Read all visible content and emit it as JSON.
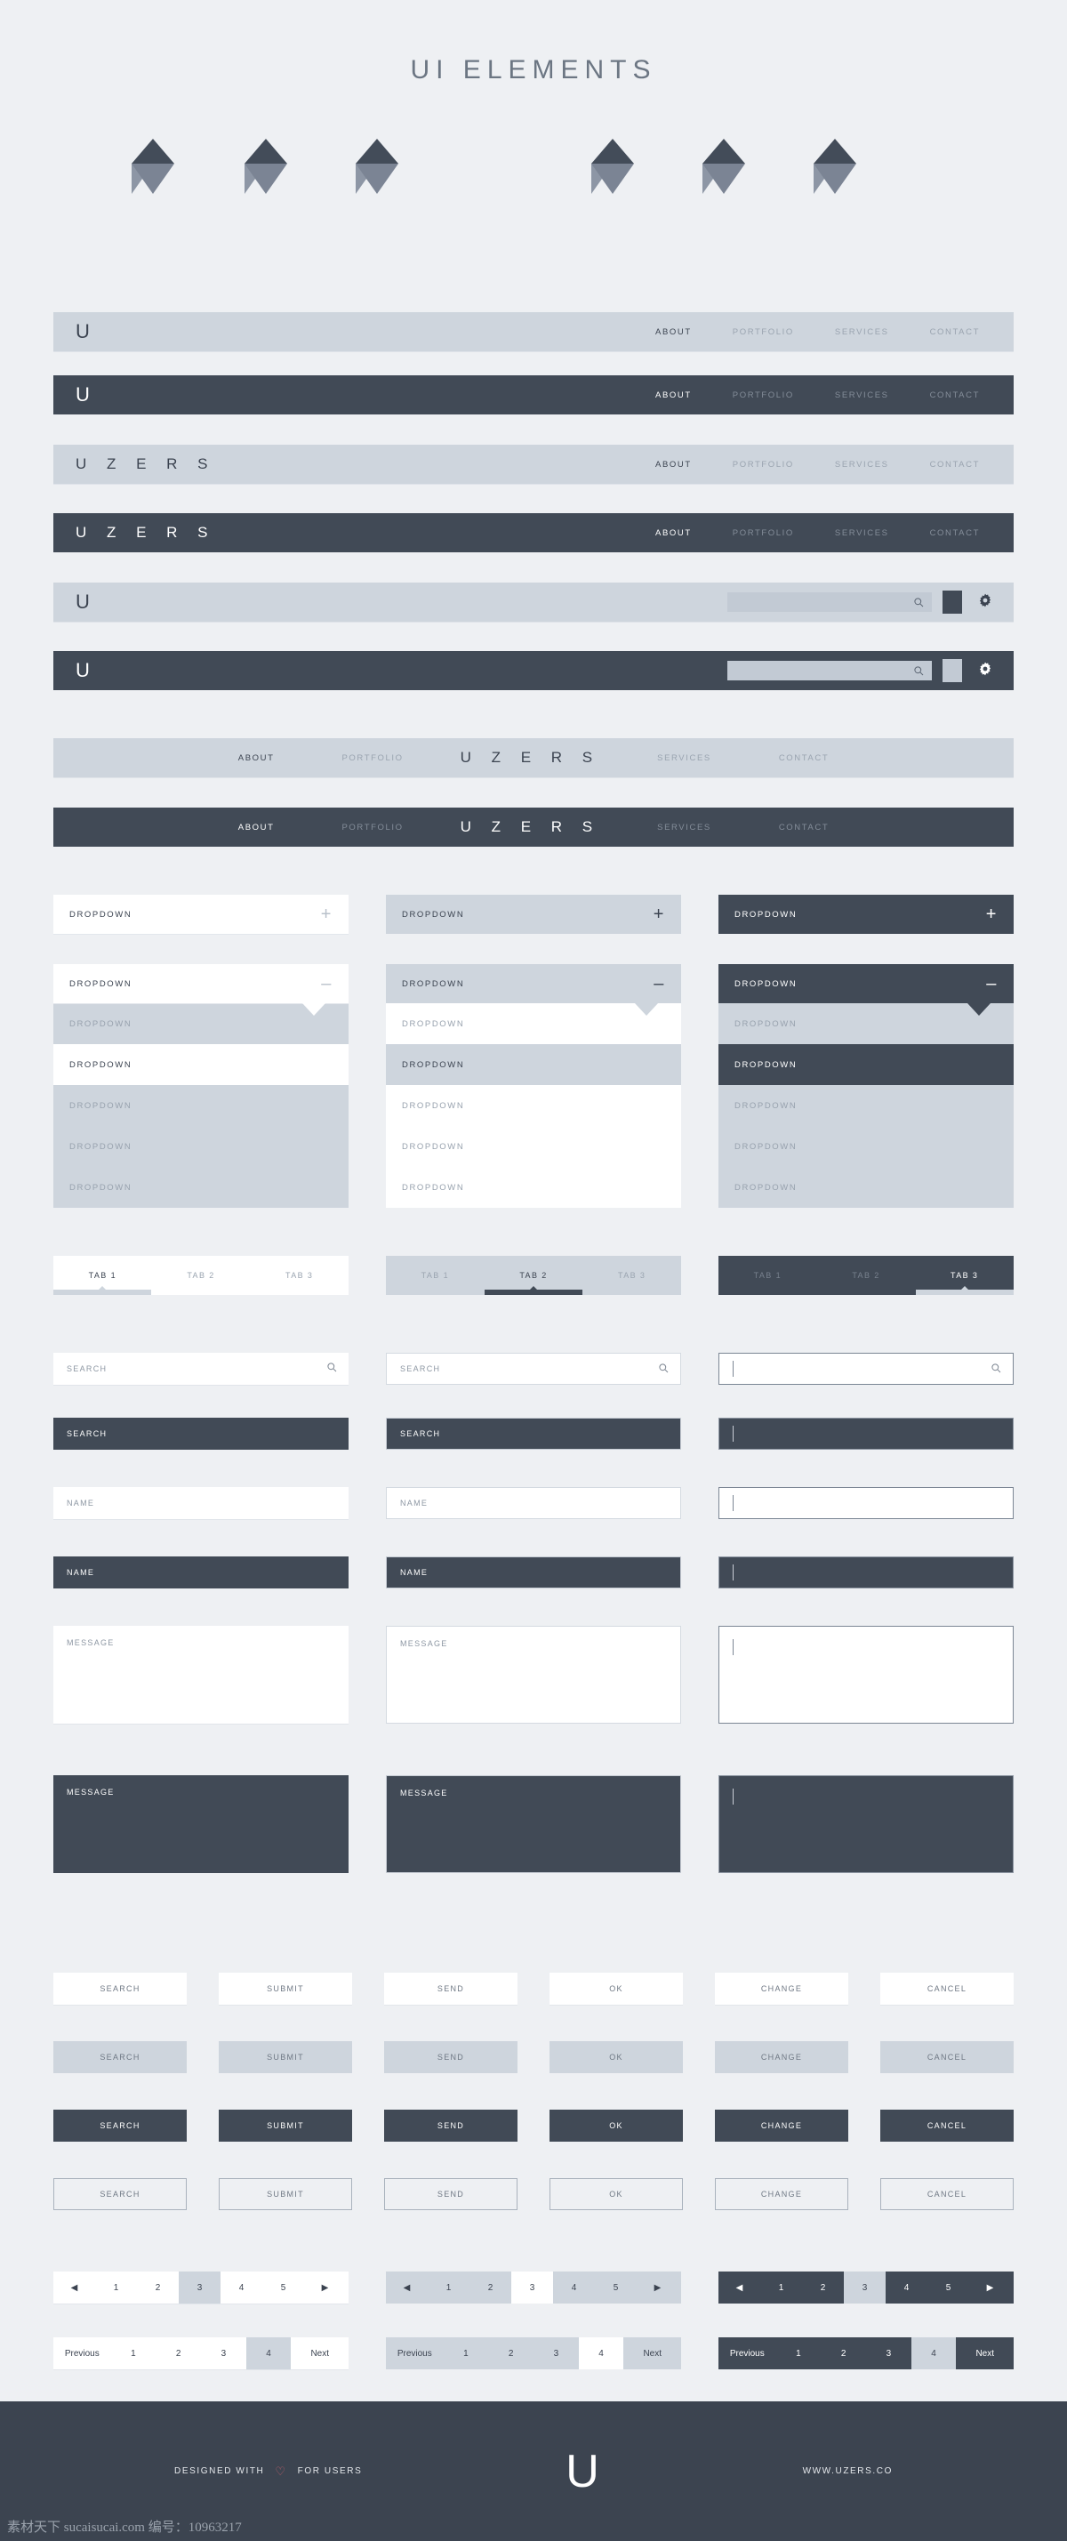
{
  "page": {
    "title": "UI ELEMENTS",
    "background": "#eef0f3",
    "dark": "#414a56",
    "mid": "#ced5dd",
    "accent_heart": "#c0616b"
  },
  "diamonds": {
    "count": 6,
    "top_color": "#434c59",
    "bottom_color": "#7b8494"
  },
  "logo": {
    "mark": "U",
    "wordmark": "U Z E R S"
  },
  "navbars": [
    {
      "variant": "light",
      "logo_type": "mark",
      "links": [
        "ABOUT",
        "PORTFOLIO",
        "SERVICES",
        "CONTACT"
      ],
      "active": "ABOUT"
    },
    {
      "variant": "dark",
      "logo_type": "mark",
      "links": [
        "ABOUT",
        "PORTFOLIO",
        "SERVICES",
        "CONTACT"
      ],
      "active": "ABOUT"
    },
    {
      "variant": "light",
      "logo_type": "word",
      "links": [
        "ABOUT",
        "PORTFOLIO",
        "SERVICES",
        "CONTACT"
      ],
      "active": "ABOUT"
    },
    {
      "variant": "dark",
      "logo_type": "word",
      "links": [
        "ABOUT",
        "PORTFOLIO",
        "SERVICES",
        "CONTACT"
      ],
      "active": "ABOUT"
    }
  ],
  "search_navs": [
    {
      "variant": "light",
      "logo_type": "mark",
      "search_value": "",
      "search_placeholder": ""
    },
    {
      "variant": "dark",
      "logo_type": "mark",
      "search_value": "",
      "search_placeholder": ""
    }
  ],
  "centered_navs": [
    {
      "variant": "light",
      "left": [
        "ABOUT",
        "PORTFOLIO"
      ],
      "right": [
        "SERVICES",
        "CONTACT"
      ],
      "active": "ABOUT"
    },
    {
      "variant": "dark",
      "left": [
        "ABOUT",
        "PORTFOLIO"
      ],
      "right": [
        "SERVICES",
        "CONTACT"
      ],
      "active": "ABOUT"
    }
  ],
  "dropdowns": {
    "label": "DROPDOWN",
    "closed_sign": "+",
    "open_sign": "–",
    "items": [
      "DROPDOWN",
      "DROPDOWN",
      "DROPDOWN",
      "DROPDOWN",
      "DROPDOWN"
    ],
    "variants": [
      "white",
      "light",
      "dark"
    ]
  },
  "tabs": [
    {
      "variant": "light",
      "labels": [
        "TAB 1",
        "TAB 2",
        "TAB 3"
      ],
      "active": "TAB 1",
      "active_index": 0
    },
    {
      "variant": "mid",
      "labels": [
        "TAB 1",
        "TAB 2",
        "TAB 3"
      ],
      "active": "TAB 2",
      "active_index": 1
    },
    {
      "variant": "dark",
      "labels": [
        "TAB 1",
        "TAB 2",
        "TAB 3"
      ],
      "active": "TAB 3",
      "active_index": 2
    }
  ],
  "fields": {
    "search_label": "SEARCH",
    "name_label": "NAME",
    "message_label": "MESSAGE",
    "search_placeholder": "SEARCH",
    "name_placeholder": "NAME",
    "message_placeholder": "MESSAGE",
    "focused_value": ""
  },
  "buttons": {
    "labels": [
      "SEARCH",
      "SUBMIT",
      "SEND",
      "OK",
      "CHANGE",
      "CANCEL"
    ],
    "rows": [
      "white",
      "mid",
      "dark",
      "outline"
    ]
  },
  "pagination": {
    "arrow_prev": "◀",
    "arrow_next": "▶",
    "numbers": [
      "1",
      "2",
      "3",
      "4",
      "5"
    ],
    "active_number": "3",
    "word_prev": "Previous",
    "word_next": "Next",
    "word_numbers": [
      "1",
      "2",
      "3",
      "4"
    ],
    "word_active": "4",
    "variants": [
      "white",
      "light",
      "dark"
    ]
  },
  "footer": {
    "left_pre": "DESIGNED WITH",
    "heart": "♡",
    "left_post": "FOR USERS",
    "logo": "U",
    "right": "WWW.UZERS.CO"
  },
  "watermark": "素材天下 sucaisucai.com 编号：10963217"
}
